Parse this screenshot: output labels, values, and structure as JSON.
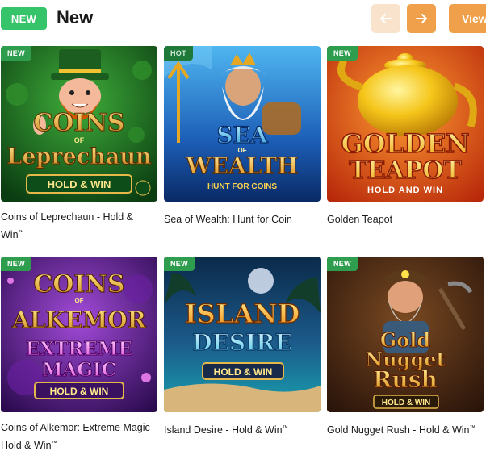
{
  "section": {
    "badge": "NEW",
    "title": "New",
    "view_label": "View"
  },
  "games": [
    {
      "tag": "NEW",
      "title": "Coins of Leprechaun - Hold & Win",
      "tm": "™",
      "art": {
        "line1": "COINS",
        "line2": "OF",
        "line3": "Leprechaun",
        "line4": "HOLD & WIN"
      }
    },
    {
      "tag": "HOT",
      "title": "Sea of Wealth: Hunt for Coin",
      "tm": "",
      "art": {
        "line1": "SEA",
        "line2": "OF",
        "line3": "WEALTH",
        "line4": "HUNT FOR COINS"
      }
    },
    {
      "tag": "NEW",
      "title": "Golden Teapot",
      "tm": "",
      "art": {
        "line1": "GOLDEN",
        "line2": "TEAPOT",
        "line3": "HOLD AND WIN"
      }
    },
    {
      "tag": "NEW",
      "title": "Coins of Alkemor: Extreme Magic - Hold & Win",
      "tm": "™",
      "art": {
        "line1": "COINS",
        "line2": "OF",
        "line3": "ALKEMOR",
        "line4": "EXTREME",
        "line5": "MAGIC",
        "line6": "HOLD & WIN"
      }
    },
    {
      "tag": "NEW",
      "title": "Island Desire - Hold & Win",
      "tm": "™",
      "art": {
        "line1": "ISLAND",
        "line2": "DESIRE",
        "line3": "HOLD & WIN"
      }
    },
    {
      "tag": "NEW",
      "title": "Gold Nugget Rush - Hold & Win",
      "tm": "™",
      "art": {
        "line1": "Gold",
        "line2": "Nugget",
        "line3": "Rush",
        "line4": "HOLD & WIN"
      }
    }
  ],
  "colors": {
    "new_badge": "#36c46a",
    "accent_orange": "#f0a04b",
    "accent_orange_light": "#fae3cc",
    "tag_green": "#2e9d4e"
  },
  "icons": {
    "prev": "arrow-left-icon",
    "next": "arrow-right-icon"
  }
}
